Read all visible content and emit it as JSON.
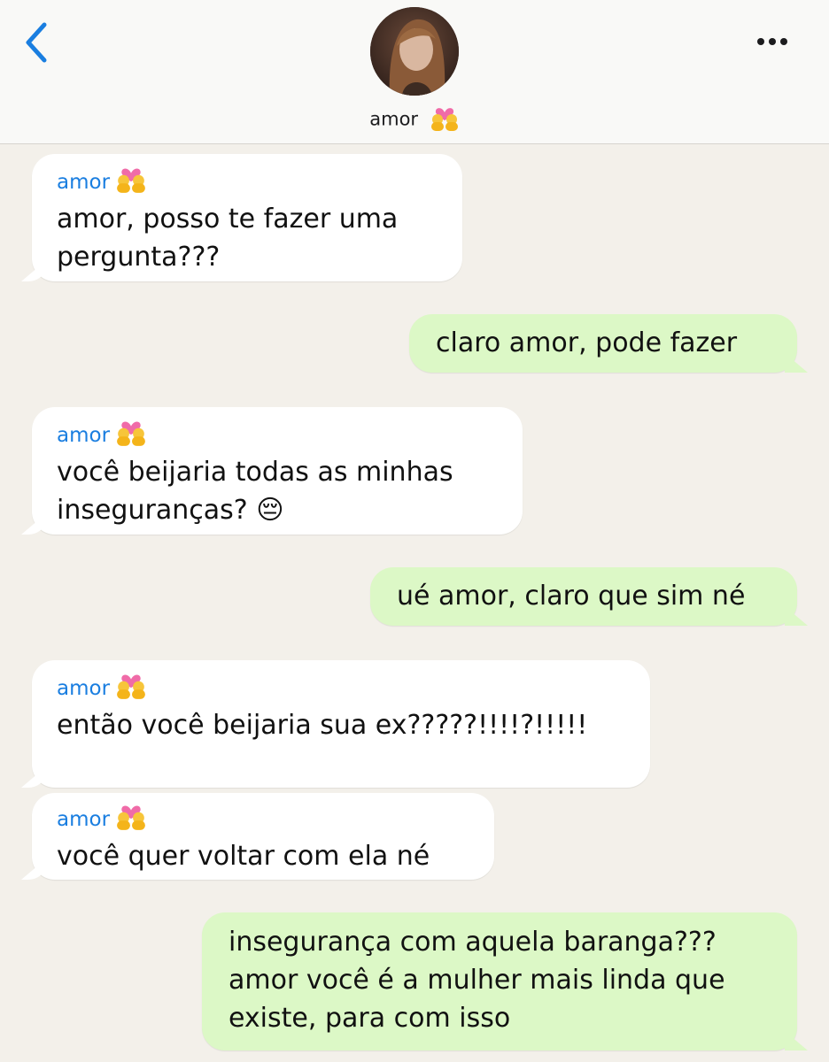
{
  "header": {
    "contact_name": "amor",
    "contact_emoji": "couple-with-heart-icon"
  },
  "messages": [
    {
      "direction": "in",
      "sender": "amor",
      "text": "amor, posso te fazer uma\npergunta???"
    },
    {
      "direction": "out",
      "text": "claro amor, pode fazer"
    },
    {
      "direction": "in",
      "sender": "amor",
      "text": "você beijaria todas as minhas\ninseguranças? 😔"
    },
    {
      "direction": "out",
      "text": "ué amor, claro que sim né"
    },
    {
      "direction": "in",
      "sender": "amor",
      "text": "então você beijaria sua ex?????!!!!?!!!!!"
    },
    {
      "direction": "in",
      "sender": "amor",
      "text": "você quer voltar com ela né"
    },
    {
      "direction": "out",
      "text": "insegurança com aquela baranga???\namor você é a mulher mais linda que\nexiste, para com isso"
    }
  ],
  "colors": {
    "incoming_bubble": "#ffffff",
    "outgoing_bubble": "#dcf8c6",
    "sender_name": "#1a7ee0",
    "accent": "#1a7ee0"
  }
}
